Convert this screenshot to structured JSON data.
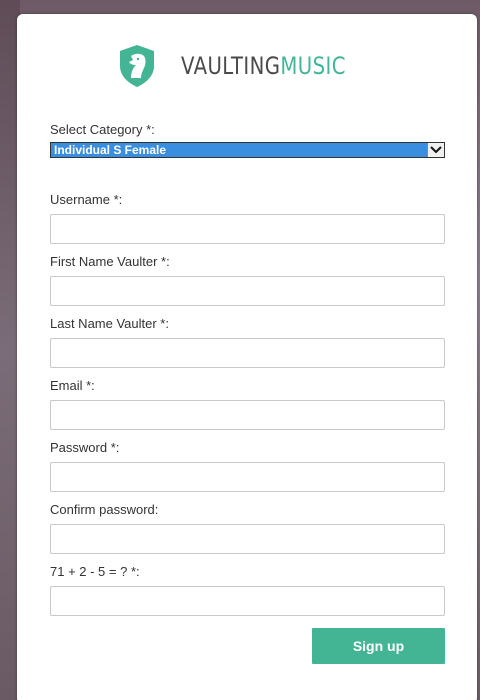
{
  "brand": {
    "name_part1": "VAULTING",
    "name_part2": "MUSIC",
    "accent_color": "#43b494",
    "logo_icon": "horse-head-shield-icon"
  },
  "form": {
    "category": {
      "label": "Select Category *:",
      "selected_value": "Individual S Female"
    },
    "username": {
      "label": "Username *:",
      "value": ""
    },
    "first_name": {
      "label": "First Name Vaulter *:",
      "value": ""
    },
    "last_name": {
      "label": "Last Name Vaulter *:",
      "value": ""
    },
    "email": {
      "label": "Email *:",
      "value": ""
    },
    "password": {
      "label": "Password *:",
      "value": ""
    },
    "confirm_password": {
      "label": "Confirm password:",
      "value": ""
    },
    "captcha": {
      "label": "71 + 2 - 5 = ? *:",
      "value": ""
    },
    "submit_label": "Sign up"
  }
}
